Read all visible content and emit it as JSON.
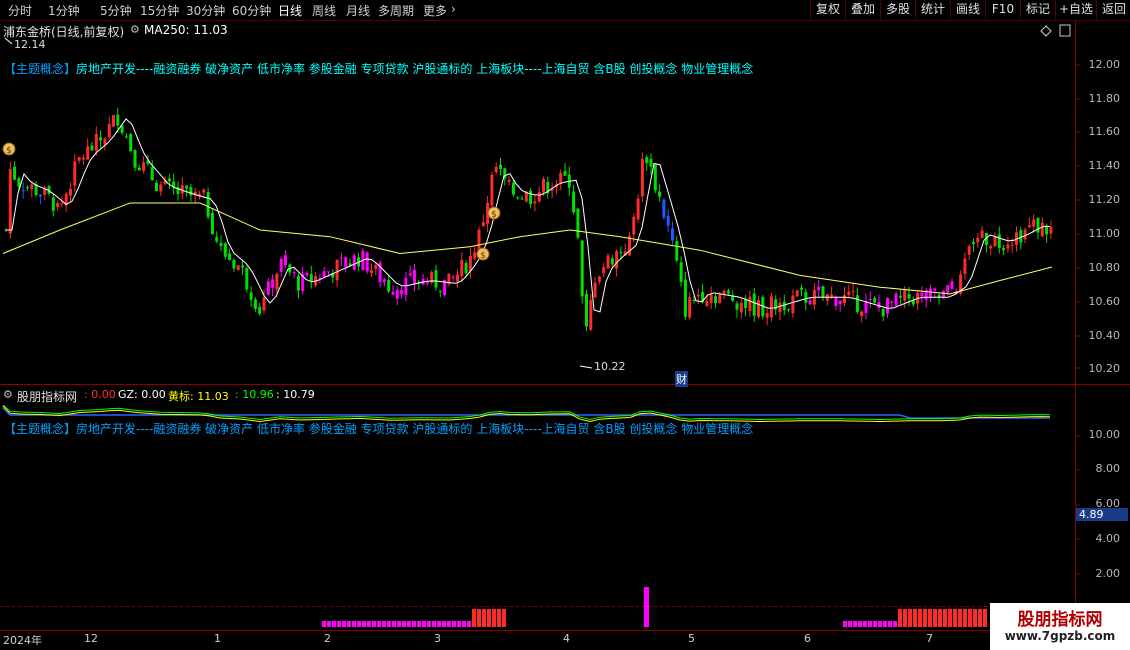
{
  "toolbar": {
    "timeframes": [
      "分时",
      "1分钟",
      "5分钟",
      "15分钟",
      "30分钟",
      "60分钟",
      "日线",
      "周线",
      "月线",
      "多周期",
      "更多"
    ],
    "active": "日线",
    "right_buttons": [
      "复权",
      "叠加",
      "多股",
      "统计",
      "画线",
      "F10",
      "标记",
      "+自选",
      "返回"
    ]
  },
  "main_panel": {
    "stock_title": "浦东金桥(日线,前复权)",
    "ma_label": "MA250: 11.03",
    "high_marker": "12.14",
    "low_marker": "10.22",
    "cai_badge": "财",
    "concept_text_prefix": "【主题概念】",
    "concept_text": "房地产开发----融资融券 破净资产 低市净率 参股金融 专项贷款 沪股通标的 上海板块----上海自贸 含B股 创投概念 物业管理概念",
    "price_labels": [
      "12.00",
      "11.80",
      "11.60",
      "11.40",
      "11.20",
      "11.00",
      "10.80",
      "10.60",
      "10.40",
      "10.20"
    ]
  },
  "indicator_panel": {
    "name": "股朋指标网",
    "values": [
      {
        "label": ": 0.00",
        "color": "#ff3030"
      },
      {
        "label": "GZ: 0.00",
        "color": "#ffffff"
      },
      {
        "label": "黄标: 11.03",
        "color": "#ffff00"
      },
      {
        "label": ": 10.96",
        "color": "#00ff00"
      },
      {
        "label": ": 10.79",
        "color": "#ffffff"
      }
    ],
    "concept_text": "【主题概念】房地产开发----融资融券 破净资产 低市净率 参股金融 专项贷款 沪股通标的 上海板块----上海自贸 含B股 创投概念 物业管理概念",
    "axis_labels": [
      "10.00",
      "8.00",
      "6.00",
      "4.00",
      "2.00"
    ],
    "current_value": "4.89"
  },
  "x_axis": [
    "2024年",
    "12",
    "1",
    "2",
    "3",
    "4",
    "5",
    "6",
    "7"
  ],
  "watermark": {
    "title": "股朋指标网",
    "url": "www.7gpzb.com"
  },
  "colors": {
    "up": "#ff2a2a",
    "down": "#00e000",
    "magenta": "#ff00ff",
    "blue": "#1e5cff",
    "ma_short": "#ffffff",
    "ma_long": "#ffff66",
    "grid_red": "#8b0000"
  }
}
